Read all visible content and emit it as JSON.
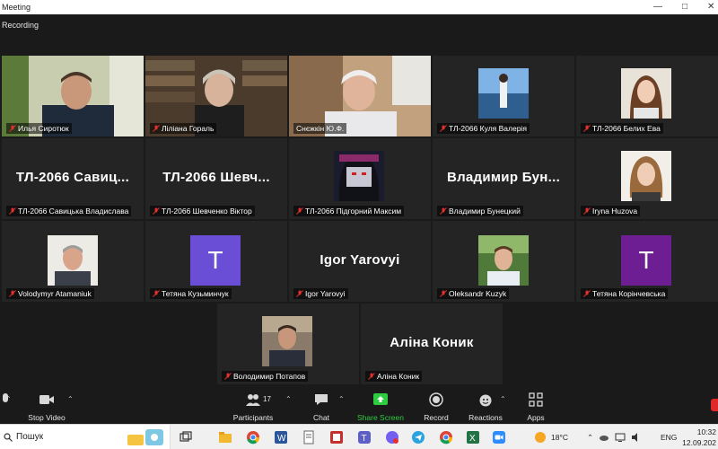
{
  "window": {
    "title": "Meeting"
  },
  "recording": {
    "label": "Recording"
  },
  "participants": [
    {
      "name": "Илья Сиротюк",
      "view": "video",
      "active": true
    },
    {
      "name": "Ліліана Гораль",
      "view": "video"
    },
    {
      "name": "Снєжкін Ю.Ф.",
      "view": "video"
    },
    {
      "name": "ТЛ-2066 Куля Валерія",
      "view": "photo"
    },
    {
      "name": "ТЛ-2066 Белих Ева",
      "view": "photo"
    },
    {
      "name": "ТЛ-2066 Савицька Владислава",
      "view": "text",
      "display": "ТЛ-2066  Савиц..."
    },
    {
      "name": "ТЛ-2066 Шевченко Віктор",
      "view": "text",
      "display": "ТЛ-2066  Шевч..."
    },
    {
      "name": "ТЛ-2066 Підгорний Максим",
      "view": "photo"
    },
    {
      "name": "Владимир Бунецкий",
      "view": "text",
      "display": "Владимир  Бун..."
    },
    {
      "name": "Iryna Huzova",
      "view": "photo"
    },
    {
      "name": "Volodymyr Atamaniuk",
      "view": "photo"
    },
    {
      "name": "Тетяна Кузьминчук",
      "view": "avatar",
      "letter": "T"
    },
    {
      "name": "Igor Yarovyi",
      "view": "text",
      "display": "Igor Yarovyi"
    },
    {
      "name": "Oleksandr Kuzyk",
      "view": "photo"
    },
    {
      "name": "Тетяна Корінчевська",
      "view": "avatar",
      "letter": "T"
    },
    {
      "name": "Володимир Потапов",
      "view": "photo"
    },
    {
      "name": "Аліна Коник",
      "view": "text",
      "display": "Аліна Коник"
    }
  ],
  "controls": {
    "stop_video": "Stop Video",
    "participants": "Participants",
    "participants_count": "17",
    "chat": "Chat",
    "share_screen": "Share Screen",
    "record": "Record",
    "reactions": "Reactions",
    "apps": "Apps"
  },
  "taskbar": {
    "search_text": "Пошук",
    "temperature": "18°C",
    "language": "ENG",
    "time": "10:32",
    "date": "12.09.202"
  },
  "colors": {
    "active_speaker": "#b9dc4a",
    "avatar_bg": "#6a4fd6",
    "share_green": "#2ecc40",
    "mic_muted": "#e03030"
  }
}
